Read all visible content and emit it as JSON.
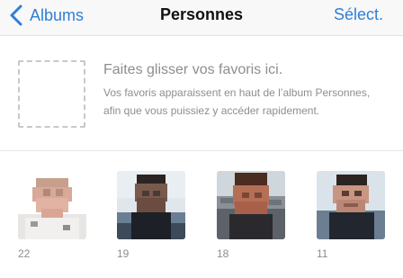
{
  "navbar": {
    "back_label": "Albums",
    "title": "Personnes",
    "select_label": "Sélect."
  },
  "favorites": {
    "title": "Faites glisser vos favoris ici.",
    "description": "Vos favoris apparaissent en haut de l’album Personnes, afin que vous puissiez y accéder rapidement."
  },
  "people": [
    {
      "count": "22"
    },
    {
      "count": "19"
    },
    {
      "count": "18"
    },
    {
      "count": "11"
    }
  ],
  "colors": {
    "accent": "#2f7fd6",
    "secondary_text": "#8e8e93"
  }
}
